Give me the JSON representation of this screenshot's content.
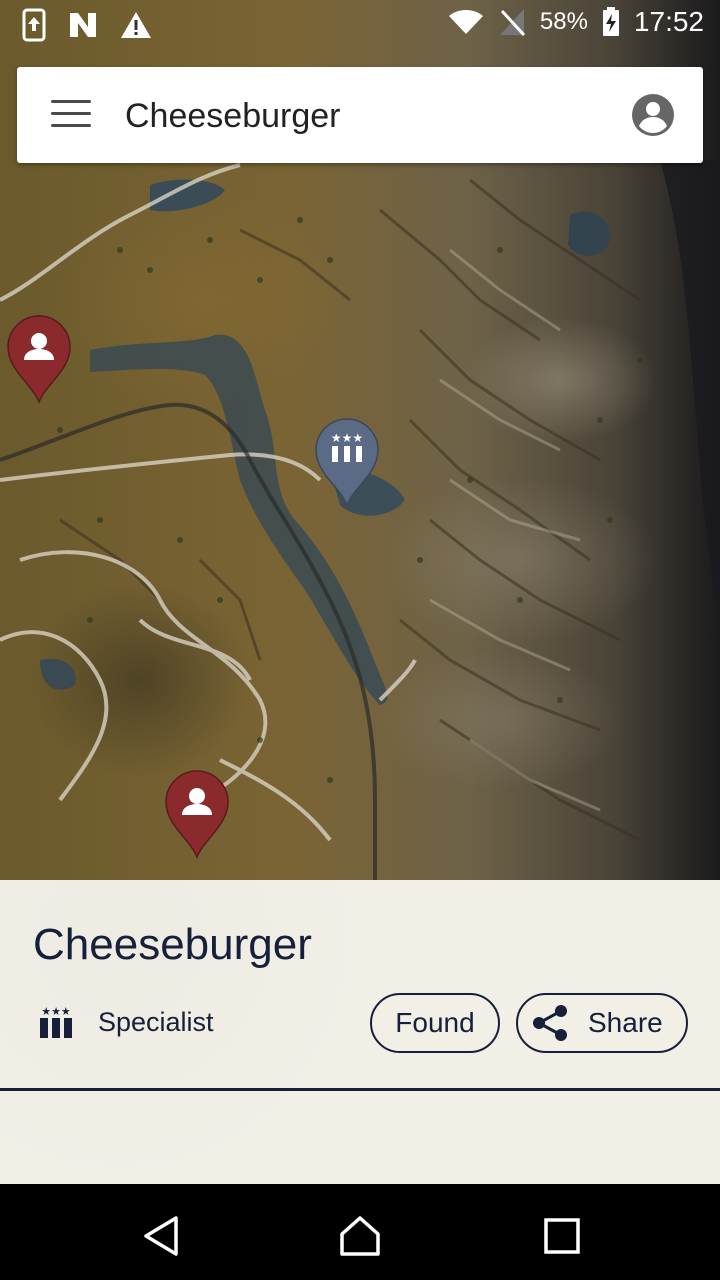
{
  "status_bar": {
    "battery_percent": "58%",
    "time": "17:52",
    "icons": [
      "upload-icon",
      "n-app-icon",
      "warning-icon",
      "wifi-icon",
      "no-signal-icon",
      "battery-charging-icon"
    ]
  },
  "search_bar": {
    "title": "Cheeseburger",
    "icons": [
      "menu-icon",
      "account-circle-icon"
    ]
  },
  "map": {
    "markers": [
      {
        "type": "character",
        "icon": "person-icon",
        "color": "#8b2a2c"
      },
      {
        "type": "specialist",
        "icon": "specialist-icon",
        "color": "#5b6b85"
      },
      {
        "type": "character",
        "icon": "person-icon",
        "color": "#8b2a2c"
      }
    ]
  },
  "detail": {
    "title": "Cheeseburger",
    "category": "Specialist",
    "category_icon": "specialist-icon",
    "found_label": "Found",
    "share_label": "Share",
    "share_icon": "share-icon"
  },
  "nav_bar": {
    "icons": [
      "back-icon",
      "home-icon",
      "recents-icon"
    ]
  },
  "colors": {
    "navy": "#16203a",
    "sheet_bg": "#f1efe6",
    "marker_red": "#8b2a2c",
    "marker_blue": "#5b6b85"
  }
}
